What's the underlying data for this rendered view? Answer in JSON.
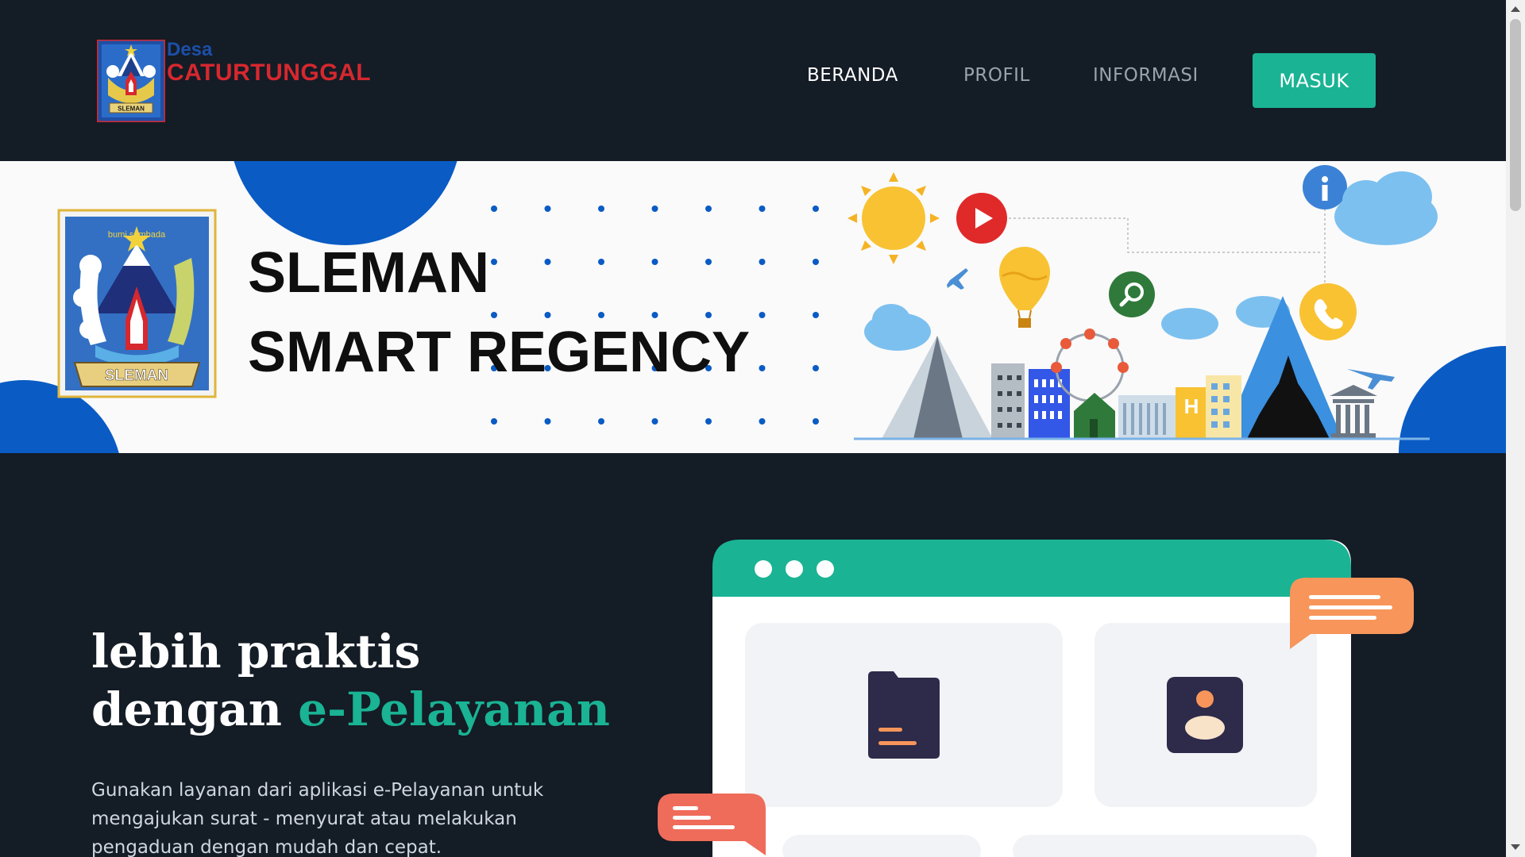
{
  "header": {
    "logo_small": "Desa",
    "logo_name": "CATURTUNGGAL",
    "emblem_label": "SLEMAN"
  },
  "nav": {
    "items": [
      {
        "label": "BERANDA",
        "active": true
      },
      {
        "label": "PROFIL",
        "active": false
      },
      {
        "label": "INFORMASI",
        "active": false
      }
    ],
    "login_label": "MASUK"
  },
  "banner": {
    "title_line1": "SLEMAN",
    "title_line2": "SMART REGENCY",
    "emblem_label": "SLEMAN",
    "emblem_top_text": "bumi sembada",
    "icons": [
      "sun-icon",
      "play-icon",
      "info-icon",
      "search-icon",
      "phone-icon",
      "airplane-icon",
      "hot-air-balloon-icon",
      "cloud-icon",
      "ferris-wheel-icon",
      "hotel-icon",
      "temple-icon",
      "museum-icon",
      "mountain-icon"
    ],
    "hotel_letter": "H"
  },
  "hero": {
    "heading_line1": "lebih praktis",
    "heading_line2_prefix": "dengan ",
    "heading_line2_accent": "e-Pelayanan",
    "description": "Gunakan layanan dari aplikasi e-Pelayanan untuk mengajukan surat - menyurat atau melakukan pengaduan dengan mudah dan cepat."
  },
  "colors": {
    "background": "#141c26",
    "accent": "#1ab394",
    "logo_blue": "#1c4fa8",
    "logo_red": "#d6282e",
    "banner_blue": "#0a5bc4",
    "chat_orange": "#f7955a",
    "chat_red": "#ef6b5a",
    "card_dark": "#2d2a4a"
  }
}
